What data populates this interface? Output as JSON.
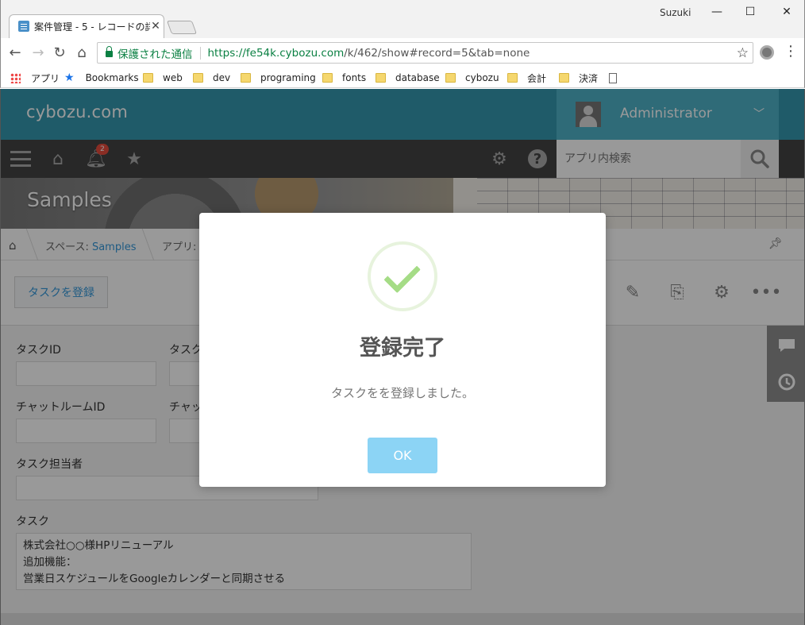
{
  "browser": {
    "tab_title": "案件管理 - 5 - レコードの詳",
    "tab_close": "✕",
    "profile_name": "Suzuki",
    "window_controls": {
      "minimize": "—",
      "maximize": "☐",
      "close": "✕"
    },
    "secure_label": "保護された通信",
    "url_host": "https://fe54k.cybozu.com",
    "url_path": "/k/462/show#record=5&tab=none",
    "bookmarks": [
      "アプリ",
      "Bookmarks",
      "web",
      "dev",
      "programing",
      "fonts",
      "database",
      "cybozu",
      "会計",
      "決済"
    ]
  },
  "header": {
    "logo": "cybozu.com",
    "user_name": "Administrator",
    "notification_count": "2",
    "search_placeholder": "アプリ内検索"
  },
  "banner": {
    "title": "Samples"
  },
  "breadcrumb": {
    "space_prefix": "スペース: ",
    "space_name": "Samples",
    "app_prefix": "アプリ: "
  },
  "actions": {
    "register_task": "タスクを登録"
  },
  "form": {
    "labels": {
      "task_id": "タスクID",
      "task_name_partial": "タスク",
      "chatroom_id": "チャットルームID",
      "chat_partial": "チャッ",
      "task_owner": "タスク担当者",
      "task": "タスク"
    },
    "task_lines": [
      "株式会社○○様HPリニューアル",
      "追加機能：",
      "営業日スケジュールをGoogleカレンダーと同期させる"
    ]
  },
  "dialog": {
    "title": "登録完了",
    "message": "タスクをを登録しました。",
    "ok_label": "OK"
  },
  "colors": {
    "header": "#3498af",
    "user_box": "#4fb2c9",
    "gnav": "#444444",
    "link": "#3498db",
    "success_check": "#a5dc86",
    "ok_button": "#8cd4f5"
  }
}
